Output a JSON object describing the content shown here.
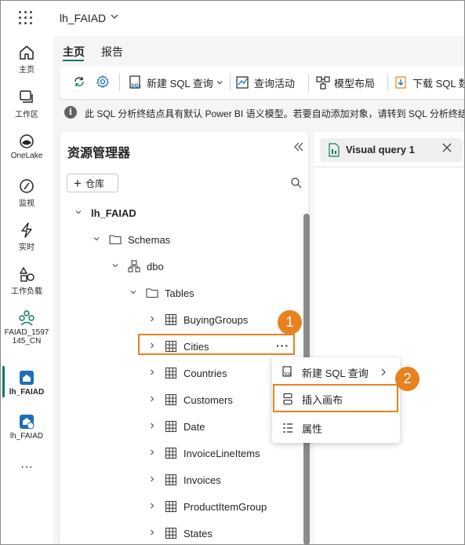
{
  "topbar": {
    "workspace_title": "lh_FAIAD"
  },
  "rail": {
    "items": [
      {
        "label": "主页",
        "icon": "home-icon"
      },
      {
        "label": "工作区",
        "icon": "workspaces-icon"
      },
      {
        "label": "OneLake",
        "icon": "onelake-icon"
      },
      {
        "label": "监视",
        "icon": "monitor-icon"
      },
      {
        "label": "实时",
        "icon": "realtime-icon"
      },
      {
        "label": "工作负载",
        "icon": "workloads-icon"
      },
      {
        "label1": "FAIAD_1597",
        "label2": "145_CN",
        "icon": "workspace-people-icon"
      },
      {
        "label": "lh_FAIAD",
        "icon": "lakehouse-icon",
        "active": true
      },
      {
        "label": "lh_FAIAD",
        "icon": "sql-endpoint-icon"
      }
    ],
    "more": "···"
  },
  "tabs": {
    "home": "主页",
    "report": "报告"
  },
  "ribbon": {
    "new_sql_query": "新建 SQL 查询",
    "query_activity": "查询活动",
    "model_layout": "模型布局",
    "download_sql": "下载 SQL 数"
  },
  "banner": {
    "text": "此 SQL 分析终结点具有默认 Power BI 语义模型。若要自动添加对象，请转到 SQL 分析终结点"
  },
  "explorer": {
    "title": "资源管理器",
    "warehouse_button": "仓库",
    "tree": {
      "root": "lh_FAIAD",
      "schemas": "Schemas",
      "dbo": "dbo",
      "tables": "Tables",
      "items": [
        "BuyingGroups",
        "Cities",
        "Countries",
        "Customers",
        "Date",
        "InvoiceLineItems",
        "Invoices",
        "ProductItemGroup",
        "States"
      ]
    },
    "more_options": "···"
  },
  "context_menu": {
    "new_sql_query": "新建 SQL 查询",
    "insert_canvas": "插入画布",
    "properties": "属性"
  },
  "badges": [
    "1",
    "2"
  ],
  "visual_query_tab": {
    "label": "Visual query 1"
  },
  "colors": {
    "accent": "#117865",
    "highlight": "#e8821e"
  }
}
